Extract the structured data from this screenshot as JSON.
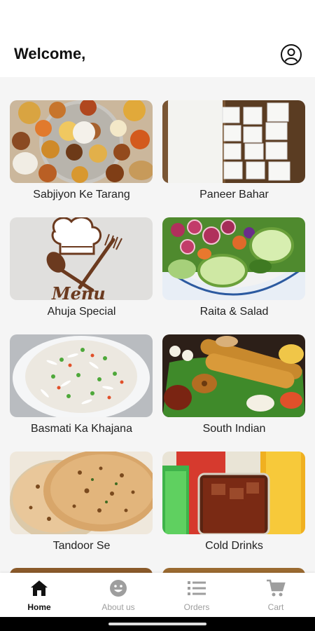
{
  "header": {
    "title": "Welcome,"
  },
  "categories": [
    {
      "label": "Sabjiyon Ke Tarang"
    },
    {
      "label": "Paneer Bahar"
    },
    {
      "label": "Ahuja Special"
    },
    {
      "label": "Raita & Salad"
    },
    {
      "label": "Basmati Ka Khajana"
    },
    {
      "label": "South Indian"
    },
    {
      "label": "Tandoor Se"
    },
    {
      "label": "Cold Drinks"
    }
  ],
  "logo_text": "Menu",
  "nav": [
    {
      "label": "Home",
      "icon": "home-icon",
      "active": true
    },
    {
      "label": "About us",
      "icon": "smile-icon"
    },
    {
      "label": "Orders",
      "icon": "list-icon"
    },
    {
      "label": "Cart",
      "icon": "cart-icon"
    }
  ],
  "colors": {
    "active_nav": "#111111",
    "inactive_nav": "#9e9e9e",
    "background": "#f5f5f5"
  }
}
